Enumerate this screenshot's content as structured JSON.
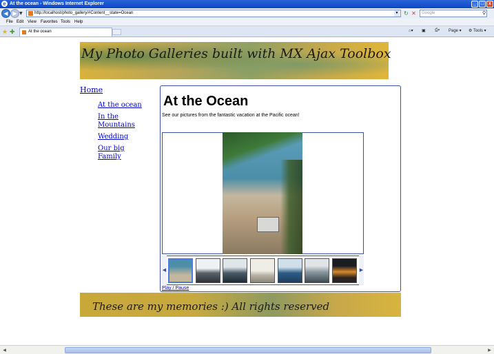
{
  "window": {
    "title": "At the ocean - Windows Internet Explorer",
    "min_icon": "minimize-icon",
    "max_icon": "maximize-icon",
    "close_icon": "close-icon"
  },
  "address_bar": {
    "url": "http://localhost/photo_gallery/#Content__state=Ocean",
    "search_placeholder": "Google"
  },
  "menu": [
    "File",
    "Edit",
    "View",
    "Favorites",
    "Tools",
    "Help"
  ],
  "tabs": [
    {
      "label": "At the ocean"
    }
  ],
  "toolbar": {
    "page_label": "Page",
    "tools_label": "Tools"
  },
  "site": {
    "header_text": "My Photo Galleries built with MX Ajax Toolbox",
    "home_link": "Home",
    "nav": [
      {
        "label": "At the ocean"
      },
      {
        "label": "In the Mountains"
      },
      {
        "label": "Wedding"
      },
      {
        "label": "Our big Family"
      }
    ],
    "page_title": "At the Ocean",
    "description": "See our pictures from the fantastic vacation at the Pacific ocean!",
    "play_pause": "Play / Pause",
    "footer_text": "These are my memories :) All rights reserved",
    "thumbnails": 7,
    "selected_thumbnail": 1
  },
  "colors": {
    "link": "#0000cc",
    "panel_border": "#3d4fa5",
    "selected_thumb_border": "#4a7de0"
  }
}
